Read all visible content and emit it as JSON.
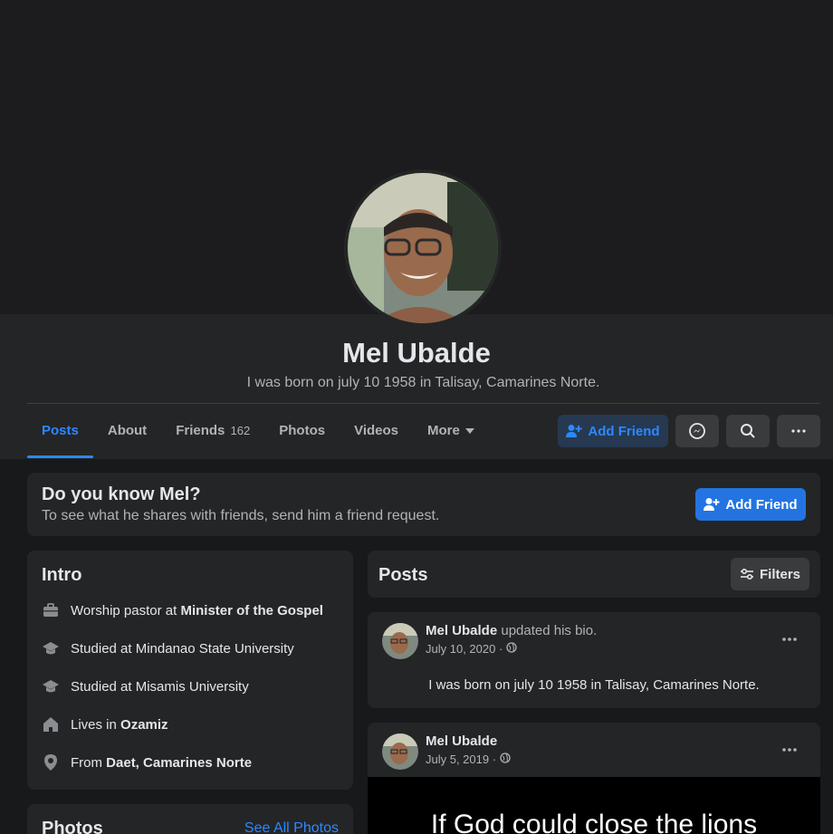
{
  "profile": {
    "name": "Mel Ubalde",
    "bio": "I was born on july 10 1958 in Talisay, Camarines Norte."
  },
  "tabs": [
    {
      "label": "Posts",
      "active": true
    },
    {
      "label": "About"
    },
    {
      "label": "Friends",
      "count": "162"
    },
    {
      "label": "Photos"
    },
    {
      "label": "Videos"
    },
    {
      "label": "More"
    }
  ],
  "actions": {
    "add_friend": "Add Friend"
  },
  "know": {
    "title": "Do you know Mel?",
    "subtitle": "To see what he shares with friends, send him a friend request.",
    "button": "Add Friend"
  },
  "intro": {
    "title": "Intro",
    "items": [
      {
        "icon": "briefcase-icon",
        "prefix": "Worship pastor at ",
        "bold": "Minister of the Gospel"
      },
      {
        "icon": "graduation-cap-icon",
        "prefix": "Studied at Mindanao State University",
        "bold": ""
      },
      {
        "icon": "graduation-cap-icon",
        "prefix": "Studied at Misamis University",
        "bold": ""
      },
      {
        "icon": "home-icon",
        "prefix": "Lives in ",
        "bold": "Ozamiz"
      },
      {
        "icon": "location-pin-icon",
        "prefix": "From ",
        "bold": "Daet, Camarines Norte"
      }
    ]
  },
  "photos": {
    "title": "Photos",
    "see_all": "See All Photos"
  },
  "posts": {
    "title": "Posts",
    "filters": "Filters",
    "items": [
      {
        "author": "Mel Ubalde",
        "action": " updated his bio.",
        "date": "July 10, 2020 ·",
        "text": "I was born on july 10 1958 in Talisay, Camarines Norte."
      },
      {
        "author": "Mel Ubalde",
        "action": "",
        "date": "July 5, 2019 ·",
        "image_text": "If God could close the lions"
      }
    ]
  },
  "colors": {
    "accent": "#2d88ff",
    "button_blue": "#2374e1",
    "panel": "#242526",
    "background": "#18191a"
  }
}
